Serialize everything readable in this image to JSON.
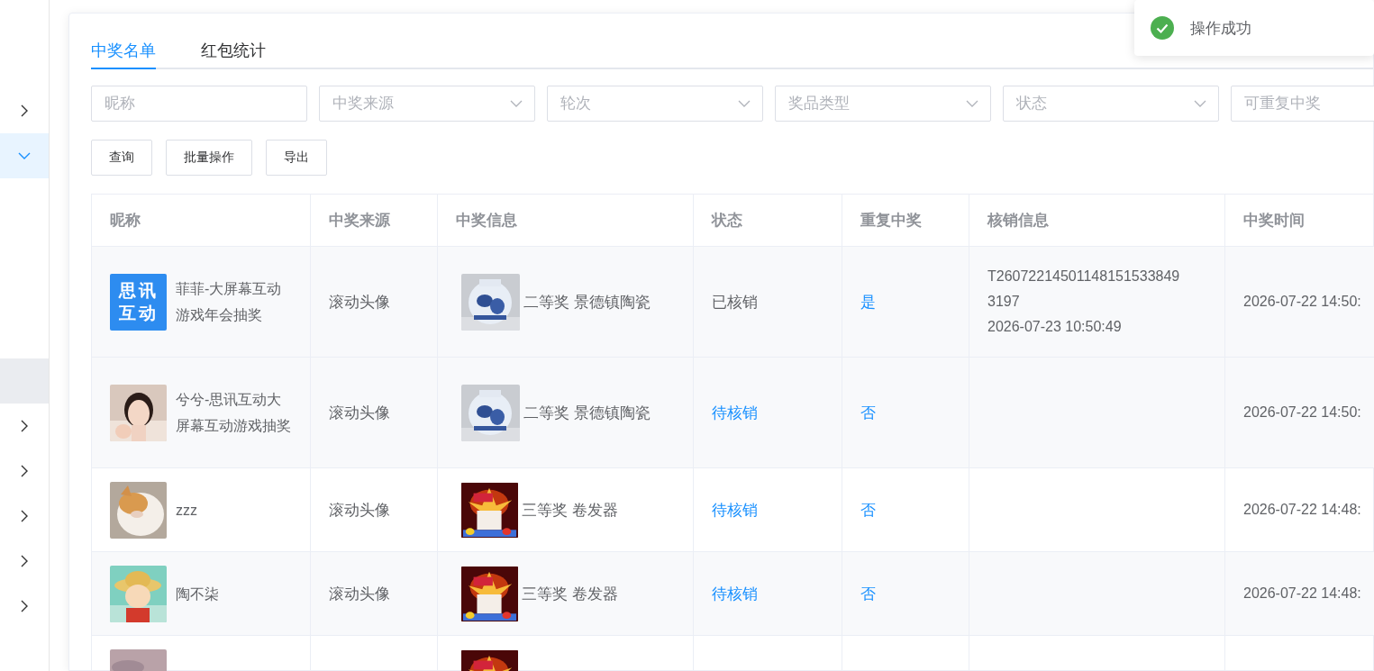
{
  "sidebar": {
    "items": [
      {
        "kind": "group",
        "expanded": false
      },
      {
        "kind": "group",
        "expanded": true,
        "children": [
          {
            "selected": true
          }
        ]
      },
      {
        "kind": "group",
        "expanded": false
      },
      {
        "kind": "group",
        "expanded": false
      },
      {
        "kind": "group",
        "expanded": false
      },
      {
        "kind": "group",
        "expanded": false
      },
      {
        "kind": "group",
        "expanded": false
      }
    ]
  },
  "tabs": [
    {
      "label": "中奖名单",
      "selected": true
    },
    {
      "label": "红包统计",
      "selected": false
    }
  ],
  "filters": [
    {
      "kind": "input",
      "placeholder": "昵称"
    },
    {
      "kind": "select",
      "placeholder": "中奖来源"
    },
    {
      "kind": "select",
      "placeholder": "轮次"
    },
    {
      "kind": "select",
      "placeholder": "奖品类型"
    },
    {
      "kind": "select",
      "placeholder": "状态"
    },
    {
      "kind": "input",
      "placeholder": "可重复中奖"
    }
  ],
  "buttons": [
    "查询",
    "批量操作",
    "导出"
  ],
  "table": {
    "columns": [
      "昵称",
      "中奖来源",
      "中奖信息",
      "状态",
      "重复中奖",
      "核销信息",
      "中奖时间"
    ],
    "rows": [
      {
        "shaded": true,
        "avatar": {
          "kind": "logo",
          "text": [
            "思讯",
            "互动"
          ]
        },
        "nickname": "菲菲-大屏幕互动游戏年会抽奖",
        "source": "滚动头像",
        "prize": "二等奖 景德镇陶瓷",
        "status": "已核销",
        "verified": true,
        "repeat": "是",
        "verification": [
          "T26072214501148151533849",
          "3197",
          "2026-07-23 10:50:49"
        ],
        "time": "2026-07-22 14:50:"
      },
      {
        "shaded": true,
        "nickname": "兮兮-思讯互动大屏幕互动游戏抽奖",
        "source": "滚动头像",
        "prize": "二等奖 景德镇陶瓷",
        "status": "待核销",
        "verified": false,
        "repeat": "否",
        "time": "2026-07-22 14:50:"
      },
      {
        "shaded": false,
        "nickname": "zzz",
        "source": "滚动头像",
        "prize": "三等奖 卷发器",
        "status": "待核销",
        "verified": false,
        "repeat": "否",
        "time": "2026-07-22 14:48:"
      },
      {
        "shaded": true,
        "nickname": "陶不柒",
        "source": "滚动头像",
        "prize": "三等奖 卷发器",
        "status": "待核销",
        "verified": false,
        "repeat": "否",
        "time": "2026-07-22 14:48:"
      },
      {
        "shaded": false
      }
    ]
  },
  "toast": {
    "kind": "success",
    "message": "操作成功"
  }
}
